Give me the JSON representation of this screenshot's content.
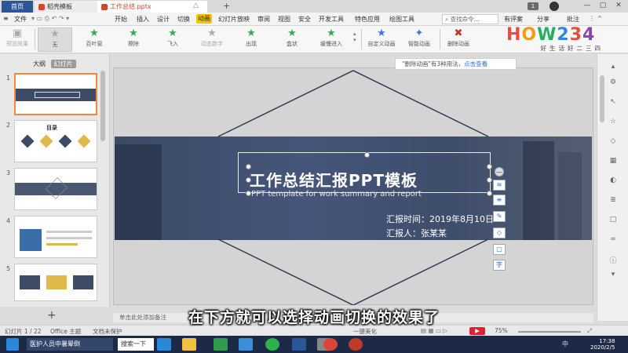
{
  "tabs": {
    "home": "首页",
    "template": "稻壳模板",
    "file": "工作总结.pptx"
  },
  "window": {
    "badge_count": "1"
  },
  "menu": {
    "file": "文件",
    "items": [
      "开始",
      "插入",
      "设计",
      "切换",
      "动画",
      "幻灯片放映",
      "审阅",
      "视图",
      "安全",
      "开发工具",
      "特色应用",
      "绘图工具"
    ],
    "search_placeholder": "查找命令...",
    "changes": "有评案",
    "share": "分享",
    "comment": "批注"
  },
  "ribbon": {
    "preview": "预览效果",
    "effects": [
      "无",
      "百叶窗",
      "擦除",
      "飞入",
      "动态数字",
      "出现",
      "盒状",
      "缓慢进入"
    ],
    "custom": "自定义动画",
    "smart": "智能动画",
    "delete": "删除动画"
  },
  "logo": {
    "text": "HOW234",
    "tagline": "好生活好二三四"
  },
  "left_panel": {
    "tab_outline": "大纲",
    "tab_thumbs": "幻灯片",
    "slide_numbers": [
      "1",
      "2",
      "3",
      "4",
      "5"
    ],
    "thumb2_title": "目录",
    "add_icon": "+"
  },
  "notification": {
    "text": "\"删除动画\"有3种用法，",
    "link": "点击查看"
  },
  "slide": {
    "title": "工作总结汇报PPT模板",
    "subtitle": "PPT template for work summary and report",
    "date": "汇报时间：2019年8月10日",
    "reporter": "汇报人：张某某"
  },
  "side_tools": [
    "—",
    "≋",
    "≡",
    "✎",
    "◇",
    "▢",
    "字"
  ],
  "notes": {
    "placeholder": "单击此处添加备注"
  },
  "caption": "在下方就可以选择动画切换的效果了",
  "status": {
    "slide_index": "幻灯片 1 / 22",
    "theme": "Office 主题",
    "protect": "文档未保护",
    "beautify": "一键美化",
    "zoom": "75%"
  },
  "taskbar": {
    "app1": "医护人员中暑晕倒",
    "search": "搜索一下",
    "time": "17:38",
    "date": "2020/2/5",
    "lang": "中"
  },
  "colors": {
    "accent_anim": "#f5c400",
    "slide_band": "#3b4a66",
    "home_tab": "#2b579a",
    "taskbar": "#1c2a48"
  }
}
